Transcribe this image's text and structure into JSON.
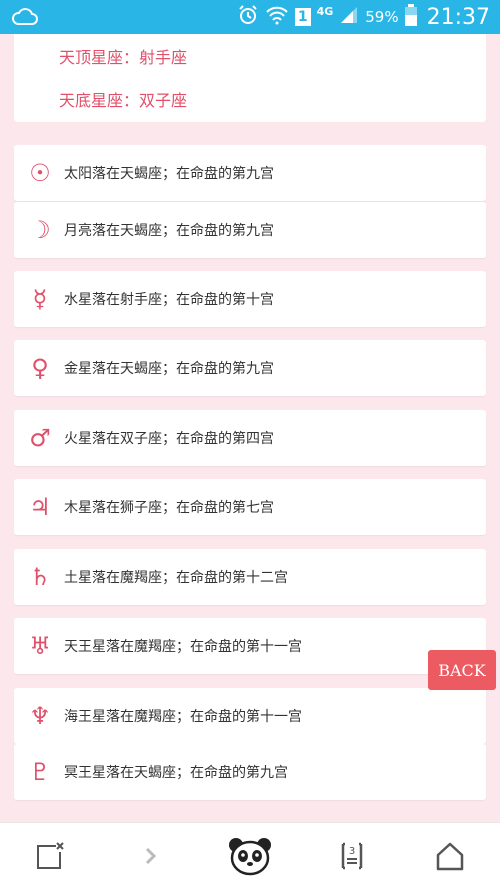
{
  "status_bar": {
    "notification_icon": "cloud-icon",
    "sim_slot": "1",
    "network": "4G",
    "battery_percent": "59%",
    "time": "21:37"
  },
  "header": {
    "midheaven": "天顶星座：射手座",
    "imum_coeli": "天底星座：双子座"
  },
  "planets": [
    {
      "icon": "sun-icon",
      "glyph": "☉",
      "text": "太阳落在天蝎座；在命盘的第九宫"
    },
    {
      "icon": "moon-icon",
      "glyph": "☽",
      "text": "月亮落在天蝎座；在命盘的第九宫"
    },
    {
      "icon": "mercury-icon",
      "glyph": "☿",
      "text": "水星落在射手座；在命盘的第十宫"
    },
    {
      "icon": "venus-icon",
      "glyph": "♀",
      "text": "金星落在天蝎座；在命盘的第九宫"
    },
    {
      "icon": "mars-icon",
      "glyph": "♂",
      "text": "火星落在双子座；在命盘的第四宫"
    },
    {
      "icon": "jupiter-icon",
      "glyph": "♃",
      "text": "木星落在狮子座；在命盘的第七宫"
    },
    {
      "icon": "saturn-icon",
      "glyph": "♄",
      "text": "土星落在魔羯座；在命盘的第十二宫"
    },
    {
      "icon": "uranus-icon",
      "glyph": "♅",
      "text": "天王星落在魔羯座；在命盘的第十一宫"
    },
    {
      "icon": "neptune-icon",
      "glyph": "♆",
      "text": "海王星落在魔羯座；在命盘的第十一宫"
    },
    {
      "icon": "pluto-icon",
      "glyph": "♇",
      "text": "冥王星落在天蝎座；在命盘的第九宫"
    }
  ],
  "back_button": {
    "label": "BACK"
  },
  "bottom_bar": {
    "tab_count": "3"
  },
  "colors": {
    "accent": "#e0506a",
    "status_bar": "#29b6e6",
    "back_button": "#ec5b62",
    "page_bg": "#fce7ec"
  }
}
